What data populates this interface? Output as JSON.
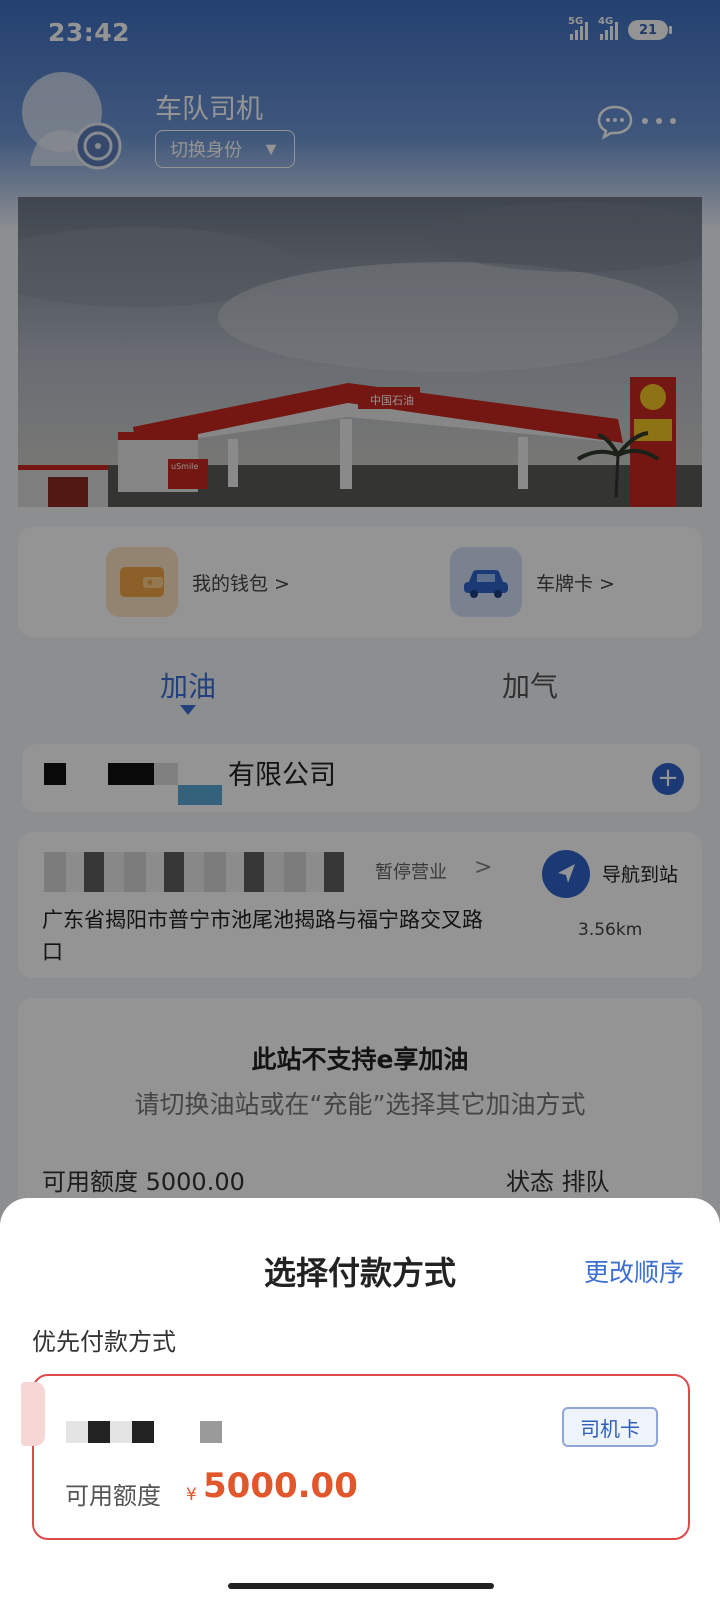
{
  "status_bar": {
    "time": "23:42",
    "network_1": "5G",
    "network_2": "4G",
    "battery": "21"
  },
  "header": {
    "role_title": "车队司机",
    "switch_identity_label": "切换身份",
    "switch_caret": "▼"
  },
  "quick_actions": [
    {
      "label": "我的钱包 >",
      "icon": "wallet-icon"
    },
    {
      "label": "车牌卡 >",
      "icon": "car-icon"
    }
  ],
  "tabs": {
    "refuel": "加油",
    "gas": "加气"
  },
  "company": {
    "name_visible": "有限公司",
    "add_label": "+"
  },
  "station": {
    "status": "暂停营业",
    "arrow": ">",
    "address": "广东省揭阳市普宁市池尾池揭路与福宁路交叉路口",
    "nav_label": "导航到站",
    "distance": "3.56km"
  },
  "notice": {
    "title": "此站不支持e享加油",
    "subtitle": "请切换油站或在“充能”选择其它加油方式",
    "peek_left": "可用额度 5000.00",
    "peek_right": "状态 排队"
  },
  "payment_sheet": {
    "title": "选择付款方式",
    "change_order": "更改顺序",
    "section_label": "优先付款方式",
    "card_type": "司机卡",
    "limit_label": "可用额度",
    "currency": "¥",
    "amount": "5000.00"
  },
  "banner": {
    "brand_text": "中国石油",
    "store_text": "uSmile"
  },
  "colors": {
    "accent_blue": "#3b6fd4",
    "warning_red": "#de4a4a",
    "amount_orange": "#e1562b"
  }
}
